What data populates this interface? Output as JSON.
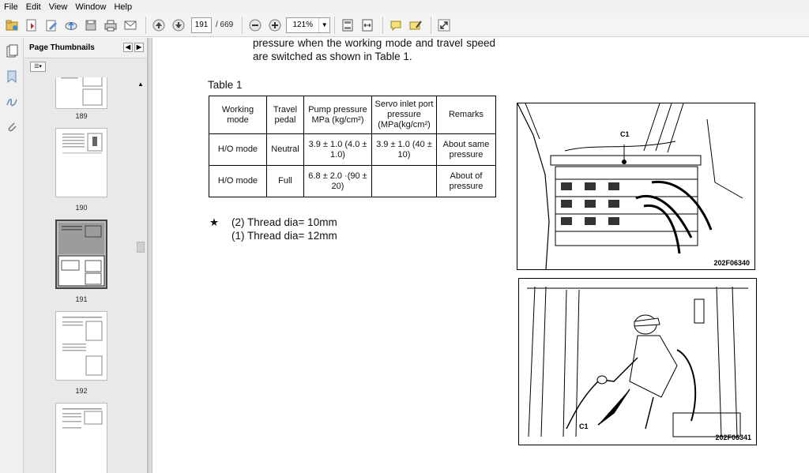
{
  "menu": [
    "File",
    "Edit",
    "View",
    "Window",
    "Help"
  ],
  "toolbar": {
    "current_page": "191",
    "total_pages": "/ 669",
    "zoom": "121%"
  },
  "panel": {
    "title": "Page Thumbnails",
    "thumbnails": [
      "189",
      "190",
      "191",
      "192"
    ]
  },
  "document": {
    "intro": "pressure when the working mode and travel speed are switched as shown in Table 1.",
    "table_title": "Table 1",
    "table": {
      "headers": [
        "Working mode",
        "Travel pedal",
        "Pump pressure MPa (kg/cm²)",
        "Servo inlet port pressure (MPa(kg/cm²)",
        "Remarks"
      ],
      "rows": [
        [
          "H/O mode",
          "Neutral",
          "3.9 ± 1.0 (4.0 ± 1.0)",
          "3.9 ± 1.0 (40 ± 10)",
          "About same pressure"
        ],
        [
          "H/O mode",
          "Full",
          "6.8 ± 2.0 ·(90 ± 20)",
          "",
          "About of pressure"
        ]
      ]
    },
    "note_star": "★",
    "note_line1": "(2) Thread dia= 10mm",
    "note_line2": "(1) Thread dia= 12mm",
    "figure1": {
      "label": "C1",
      "code": "202F06340"
    },
    "figure2": {
      "label": "C1",
      "code": "202F06341"
    }
  }
}
